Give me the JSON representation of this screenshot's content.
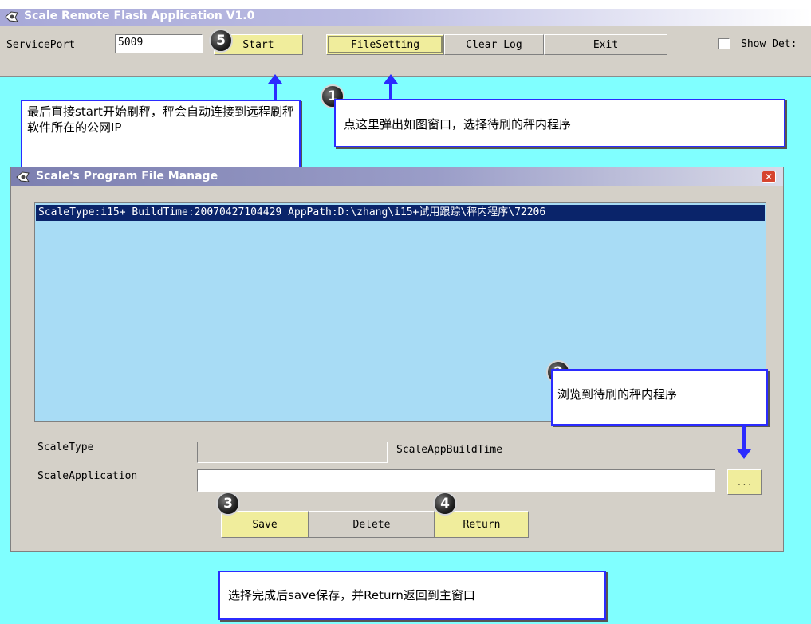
{
  "main_window": {
    "title": "Scale Remote Flash Application V1.0",
    "service_port_label": "ServicePort",
    "service_port_value": "5009",
    "buttons": {
      "start": "Start",
      "file_setting": "FileSetting",
      "clear_log": "Clear Log",
      "exit": "Exit"
    },
    "show_details_label": "Show Det:"
  },
  "dialog": {
    "title": "Scale's Program File Manage",
    "file_row": "ScaleType:i15+  BuildTime:20070427104429  AppPath:D:\\zhang\\i15+试用跟踪\\秤内程序\\72206",
    "scale_type_label": "ScaleType",
    "scale_type_value": "",
    "build_time_label": "ScaleAppBuildTime",
    "scale_app_label": "ScaleApplication",
    "scale_app_value": "",
    "browse_label": "...",
    "buttons": {
      "save": "Save",
      "delete": "Delete",
      "return": "Return"
    }
  },
  "callouts": {
    "step1": "点这里弹出如图窗口，选择待刷的秤内程序",
    "step2": "浏览到待刷的秤内程序",
    "step5": "最后直接start开始刷秤，秤会自动连接到远程刷秤软件所在的公网IP",
    "bottom": "选择完成后save保存，并Return返回到主窗口"
  },
  "badges": {
    "b1": "1",
    "b2": "2",
    "b3": "3",
    "b4": "4",
    "b5": "5"
  },
  "icons": {
    "app": "app-icon",
    "close": "close-icon"
  },
  "colors": {
    "background": "#80ffff",
    "arrow": "#2b2bff",
    "highlight": "#f0ed9c",
    "selection": "#0a246a",
    "list_bg": "#a8dcf5"
  }
}
